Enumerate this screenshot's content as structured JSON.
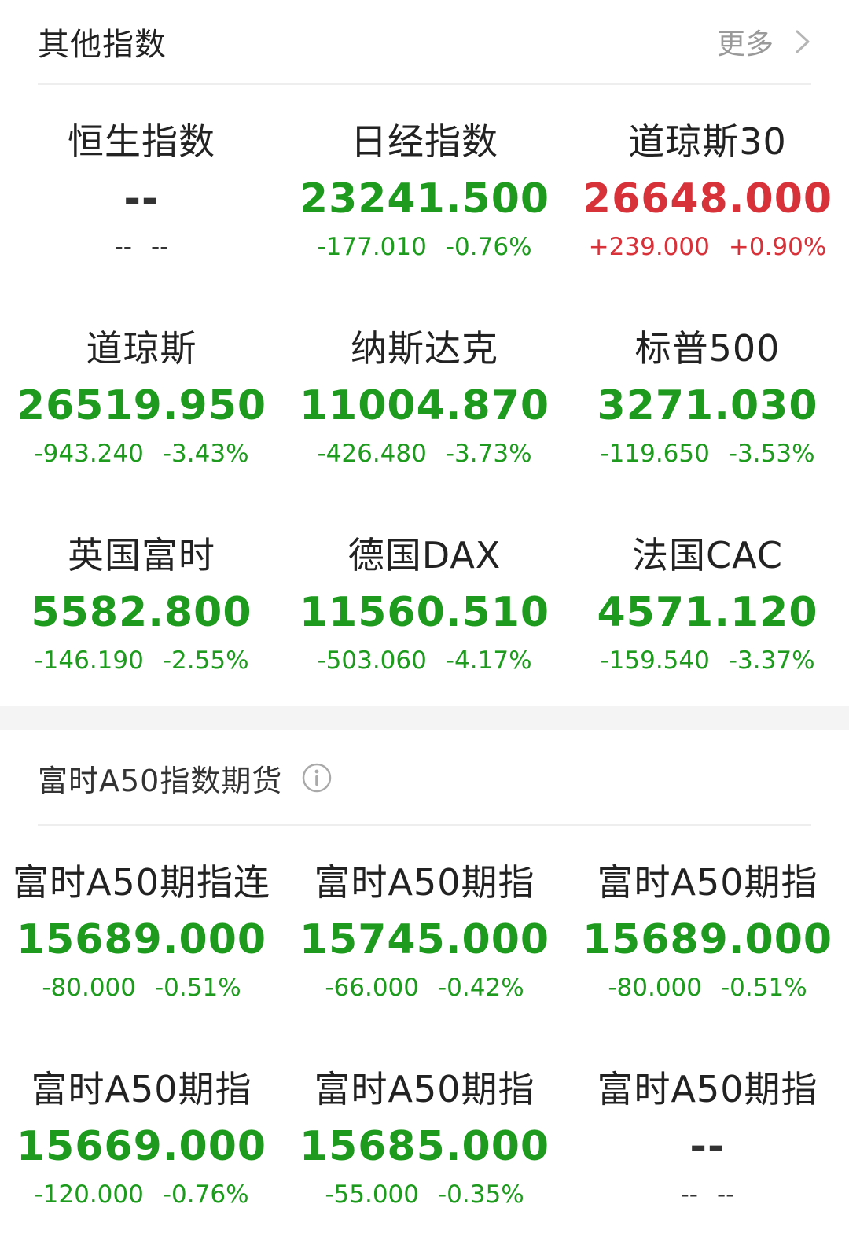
{
  "colors": {
    "down": "#1e9a1e",
    "up": "#d7323a",
    "flat": "#333333"
  },
  "section1": {
    "title": "其他指数",
    "more_label": "更多",
    "icon": "chevron-right-icon",
    "items": [
      {
        "name": "恒生指数",
        "value": "--",
        "change": "--",
        "pct": "--",
        "trend": "flat"
      },
      {
        "name": "日经指数",
        "value": "23241.500",
        "change": "-177.010",
        "pct": "-0.76%",
        "trend": "down"
      },
      {
        "name": "道琼斯30",
        "value": "26648.000",
        "change": "+239.000",
        "pct": "+0.90%",
        "trend": "up"
      },
      {
        "name": "道琼斯",
        "value": "26519.950",
        "change": "-943.240",
        "pct": "-3.43%",
        "trend": "down"
      },
      {
        "name": "纳斯达克",
        "value": "11004.870",
        "change": "-426.480",
        "pct": "-3.73%",
        "trend": "down"
      },
      {
        "name": "标普500",
        "value": "3271.030",
        "change": "-119.650",
        "pct": "-3.53%",
        "trend": "down"
      },
      {
        "name": "英国富时",
        "value": "5582.800",
        "change": "-146.190",
        "pct": "-2.55%",
        "trend": "down"
      },
      {
        "name": "德国DAX",
        "value": "11560.510",
        "change": "-503.060",
        "pct": "-4.17%",
        "trend": "down"
      },
      {
        "name": "法国CAC",
        "value": "4571.120",
        "change": "-159.540",
        "pct": "-3.37%",
        "trend": "down"
      }
    ]
  },
  "section2": {
    "title": "富时A50指数期货",
    "icon": "info-icon",
    "items": [
      {
        "name": "富时A50期指连",
        "value": "15689.000",
        "change": "-80.000",
        "pct": "-0.51%",
        "trend": "down"
      },
      {
        "name": "富时A50期指",
        "value": "15745.000",
        "change": "-66.000",
        "pct": "-0.42%",
        "trend": "down"
      },
      {
        "name": "富时A50期指",
        "value": "15689.000",
        "change": "-80.000",
        "pct": "-0.51%",
        "trend": "down"
      },
      {
        "name": "富时A50期指",
        "value": "15669.000",
        "change": "-120.000",
        "pct": "-0.76%",
        "trend": "down"
      },
      {
        "name": "富时A50期指",
        "value": "15685.000",
        "change": "-55.000",
        "pct": "-0.35%",
        "trend": "down"
      },
      {
        "name": "富时A50期指",
        "value": "--",
        "change": "--",
        "pct": "--",
        "trend": "flat"
      }
    ]
  }
}
